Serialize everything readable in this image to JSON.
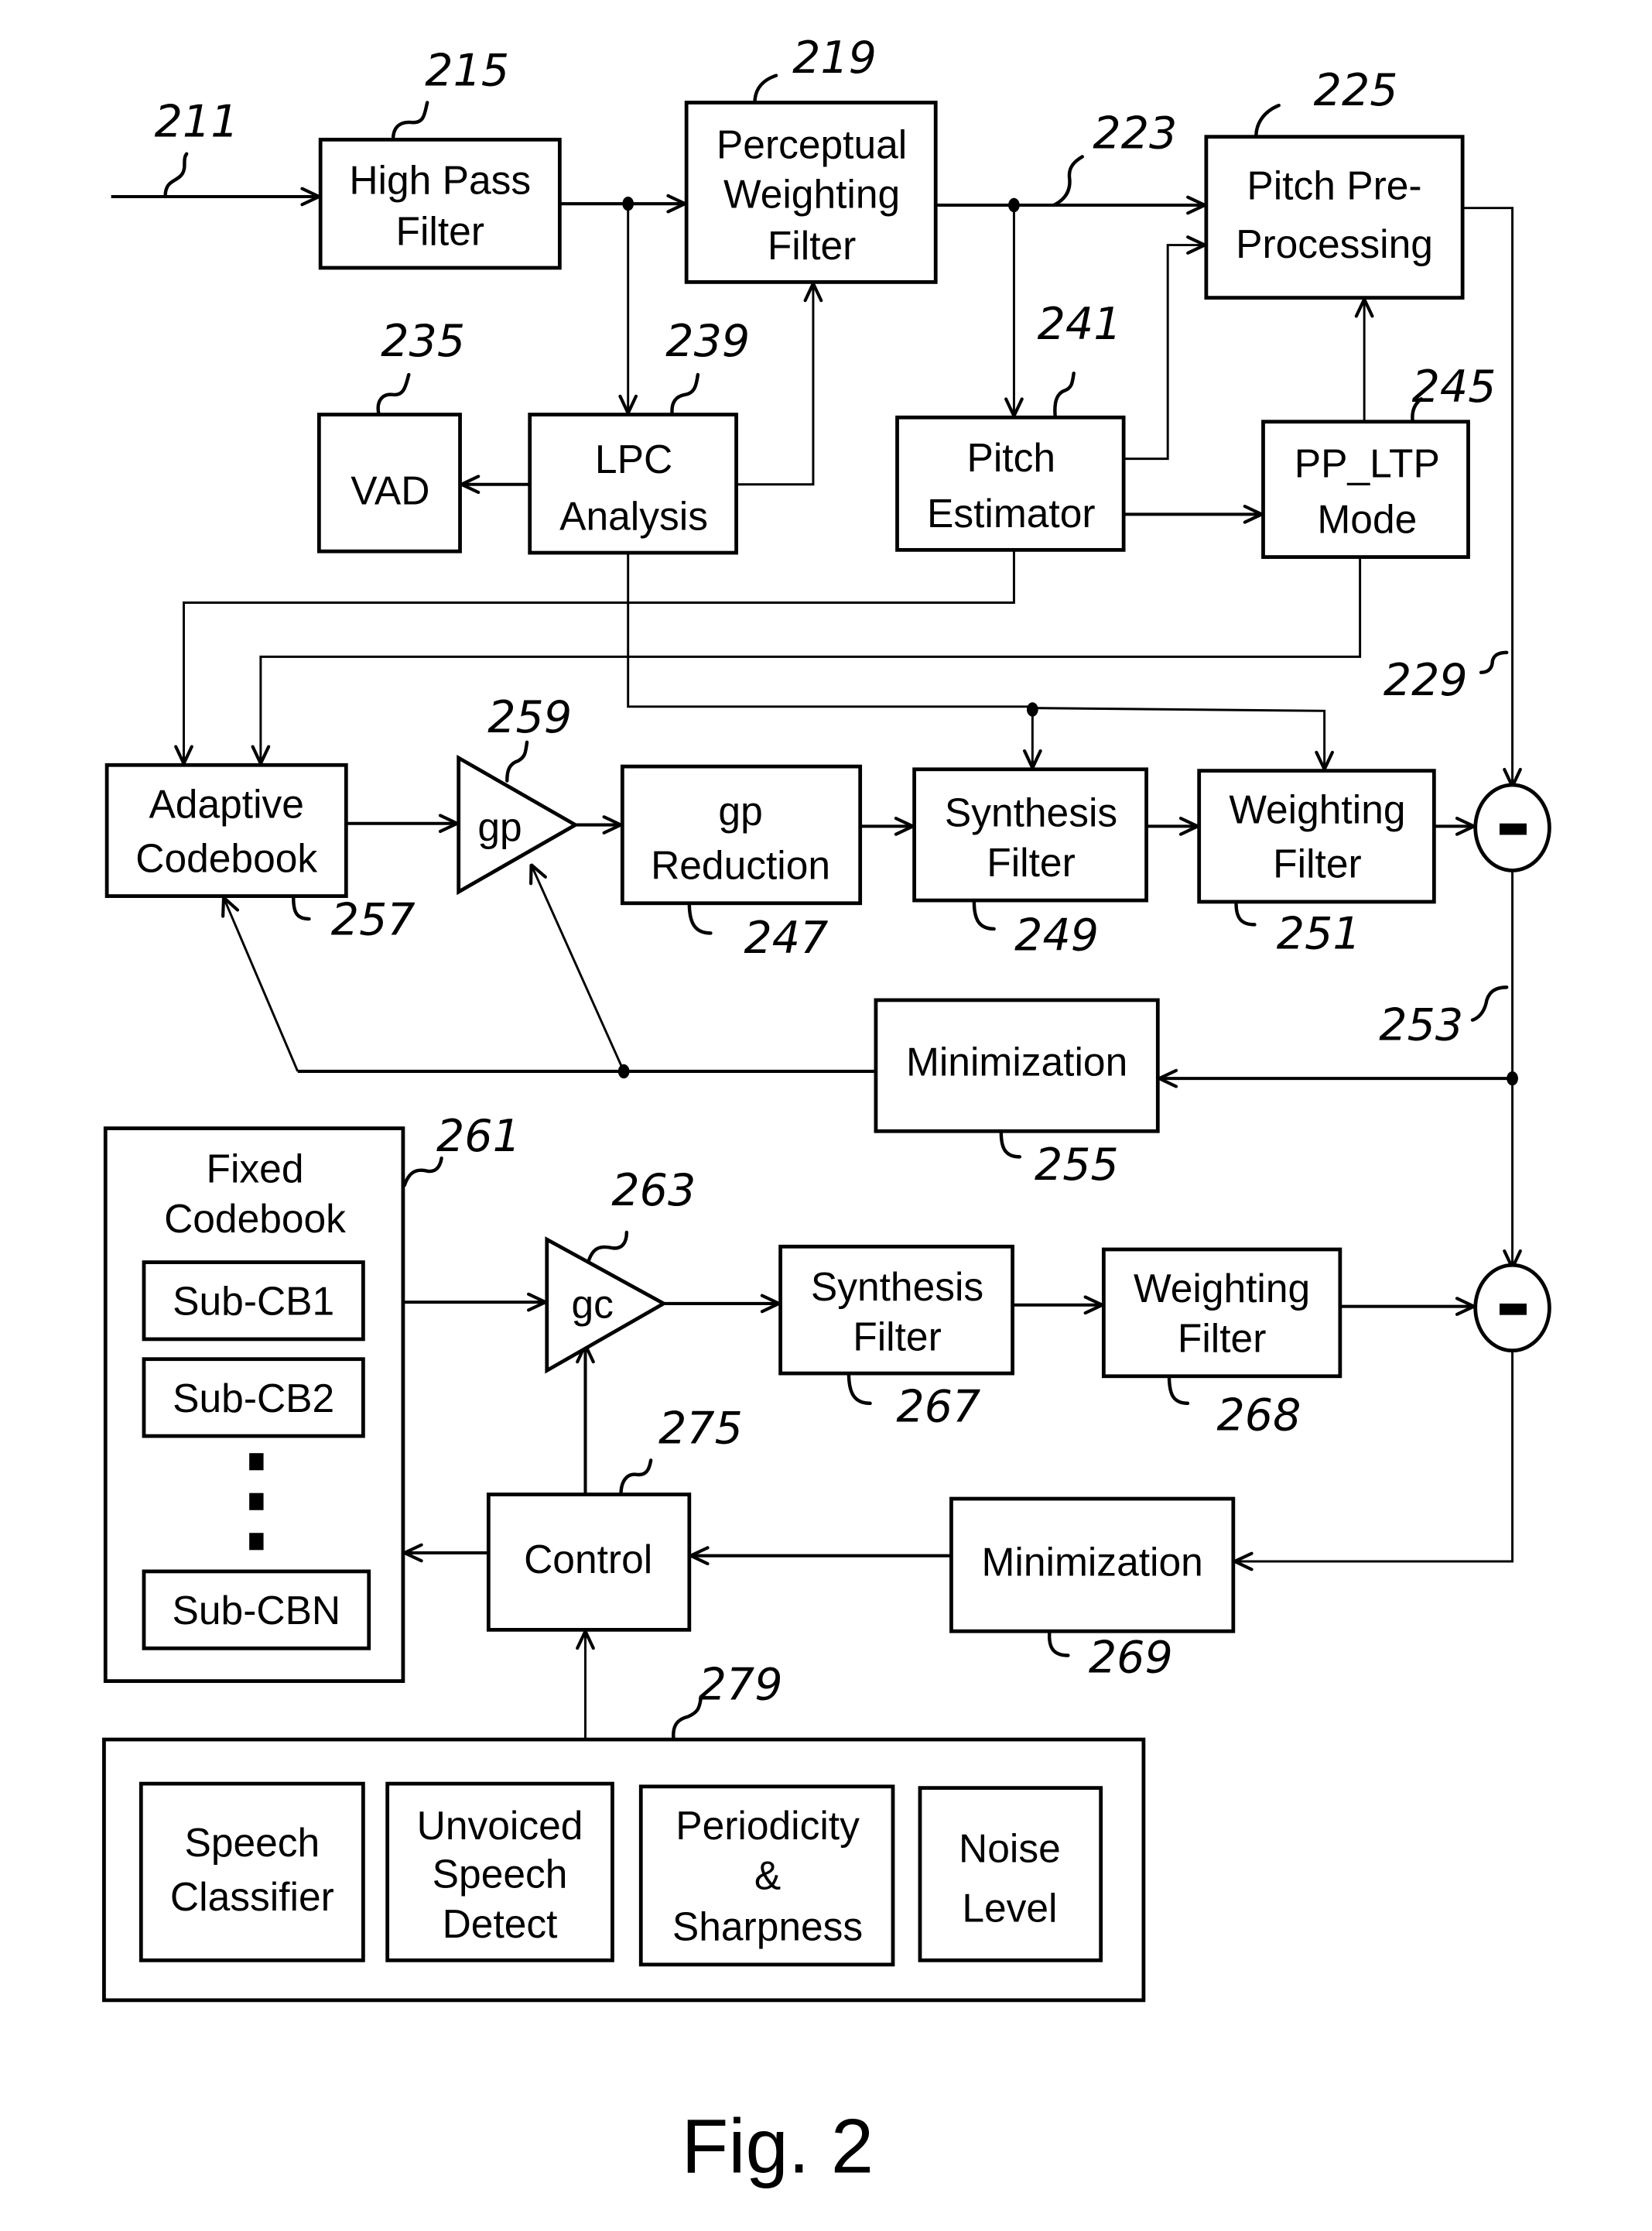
{
  "figure": {
    "caption": "Fig. 2",
    "blocks": {
      "high_pass_filter": {
        "ref": "215",
        "lines": [
          "High Pass",
          "Filter"
        ]
      },
      "perceptual_weighting_filter": {
        "ref": "219",
        "lines": [
          "Perceptual",
          "Weighting",
          "Filter"
        ]
      },
      "pitch_preprocessing": {
        "ref": "225",
        "lines": [
          "Pitch Pre-",
          "Processing"
        ]
      },
      "vad": {
        "ref": "235",
        "lines": [
          "VAD"
        ]
      },
      "lpc_analysis": {
        "ref": "239",
        "lines": [
          "LPC",
          "Analysis"
        ]
      },
      "pitch_estimator": {
        "ref": "241",
        "lines": [
          "Pitch",
          "Estimator"
        ]
      },
      "pp_ltp_mode": {
        "ref": "245",
        "lines": [
          "PP_LTP",
          "Mode"
        ]
      },
      "adaptive_codebook": {
        "ref": "257",
        "lines": [
          "Adaptive",
          "Codebook"
        ]
      },
      "gp_amplifier": {
        "ref": "259",
        "lines": [
          "gp"
        ]
      },
      "gp_reduction": {
        "ref": "247",
        "lines": [
          "gp",
          "Reduction"
        ]
      },
      "synthesis_filter_1": {
        "ref": "249",
        "lines": [
          "Synthesis",
          "Filter"
        ]
      },
      "weighting_filter_1": {
        "ref": "251",
        "lines": [
          "Weighting",
          "Filter"
        ]
      },
      "minimization_1": {
        "ref": "255",
        "lines": [
          "Minimization"
        ]
      },
      "fixed_codebook": {
        "ref": "261",
        "lines": [
          "Fixed",
          "Codebook"
        ],
        "sub_codebooks": [
          "Sub-CB1",
          "Sub-CB2",
          "Sub-CBN"
        ]
      },
      "gc_amplifier": {
        "ref": "263",
        "lines": [
          "gc"
        ]
      },
      "synthesis_filter_2": {
        "ref": "267",
        "lines": [
          "Synthesis",
          "Filter"
        ]
      },
      "weighting_filter_2": {
        "ref": "268",
        "lines": [
          "Weighting",
          "Filter"
        ]
      },
      "minimization_2": {
        "ref": "269",
        "lines": [
          "Minimization"
        ]
      },
      "control": {
        "ref": "275",
        "lines": [
          "Control"
        ]
      },
      "classifier_group": {
        "ref": "279",
        "modules": [
          {
            "lines": [
              "Speech",
              "Classifier"
            ]
          },
          {
            "lines": [
              "Unvoiced",
              "Speech",
              "Detect"
            ]
          },
          {
            "lines": [
              "Periodicity",
              "&",
              "Sharpness"
            ]
          },
          {
            "lines": [
              "Noise",
              "Level"
            ]
          }
        ]
      }
    },
    "signals": {
      "input": "211",
      "weighted_speech": "223",
      "target_signal": "229",
      "error_signal": "253"
    },
    "operators": {
      "subtractor_symbol": "minus"
    }
  }
}
